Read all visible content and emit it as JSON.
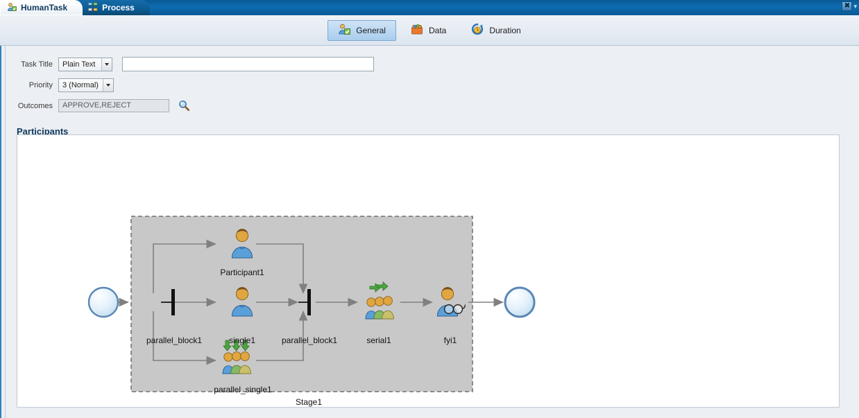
{
  "window": {
    "tabs": [
      {
        "label": "HumanTask",
        "icon": "humantask-icon",
        "active": true
      },
      {
        "label": "Process",
        "icon": "process-icon",
        "active": false
      }
    ],
    "close_label": "✖",
    "menu_caret": "▾"
  },
  "toolbar": {
    "buttons": [
      {
        "label": "General",
        "icon": "general-icon",
        "selected": true
      },
      {
        "label": "Data",
        "icon": "data-icon",
        "selected": false
      },
      {
        "label": "Duration",
        "icon": "duration-icon",
        "selected": false
      }
    ]
  },
  "form": {
    "task_title": {
      "label": "Task Title",
      "type_value": "Plain Text",
      "value": "",
      "placeholder": ""
    },
    "priority": {
      "label": "Priority",
      "value": "3 (Normal)"
    },
    "outcomes": {
      "label": "Outcomes",
      "value": "APPROVE,REJECT",
      "browse_icon": "magnifier-icon"
    }
  },
  "participants": {
    "heading": "Participants",
    "stage_label": "Stage1",
    "nodes": [
      {
        "id": "start",
        "type": "start-event",
        "label": ""
      },
      {
        "id": "split",
        "type": "parallel-bar",
        "label": "parallel_block1"
      },
      {
        "id": "participant1",
        "type": "single-participant",
        "label": "Participant1"
      },
      {
        "id": "single1",
        "type": "single-participant",
        "label": "single1"
      },
      {
        "id": "parallel_single1",
        "type": "parallel-participant",
        "label": "parallel_single1"
      },
      {
        "id": "join",
        "type": "parallel-bar",
        "label": "parallel_block1"
      },
      {
        "id": "serial1",
        "type": "serial-participant",
        "label": "serial1"
      },
      {
        "id": "fyi1",
        "type": "fyi-participant",
        "label": "fyi1"
      },
      {
        "id": "end",
        "type": "end-event",
        "label": ""
      }
    ]
  },
  "colors": {
    "titlebar": "#0a5a97",
    "accent": "#2f7fc0",
    "stage_fill": "#c8c8c8",
    "heading": "#103a5d",
    "connector": "#808080"
  }
}
